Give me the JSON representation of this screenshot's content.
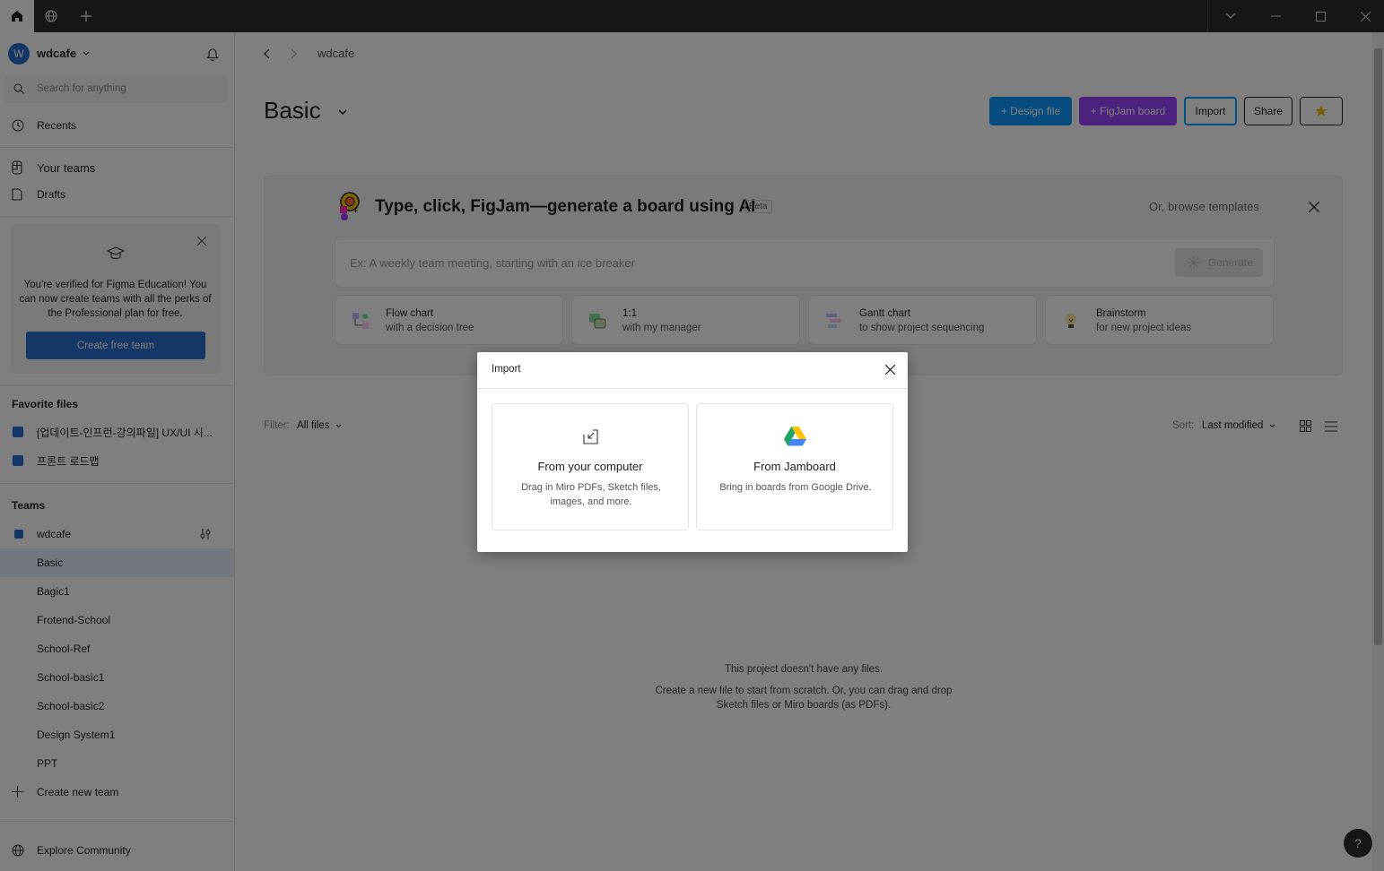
{
  "titlebar": {
    "tabs": [
      "home-tab",
      "community-tab",
      "new-tab"
    ]
  },
  "sidebar": {
    "account_initial": "W",
    "account_name": "wdcafe",
    "search_placeholder": "Search for anything",
    "recents": "Recents",
    "your_teams": "Your teams",
    "drafts": "Drafts",
    "edu_text": "You're verified for Figma Education! You can now create teams with all the perks of the Professional plan for free.",
    "edu_button": "Create free team",
    "favorite_files_heading": "Favorite files",
    "favorite_files": [
      "[업데이트-인프런-강의파일] UX/UI 시...",
      "프론트 로드맵"
    ],
    "teams_heading": "Teams",
    "team_name": "wdcafe",
    "projects": [
      "Basic",
      "Bagic1",
      "Frotend-School",
      "School-Ref",
      "School-basic1",
      "School-basic2",
      "Design System1",
      "PPT"
    ],
    "create_new_team": "Create new team",
    "explore_community": "Explore Community"
  },
  "main": {
    "breadcrumb": "wdcafe",
    "title": "Basic",
    "buttons": {
      "design_file": "+ Design file",
      "figjam_board": "+ FigJam board",
      "import": "Import",
      "share": "Share"
    },
    "ai_banner": {
      "title": "Type, click, FigJam—generate a board using AI",
      "badge": "Beta",
      "browse": "Or, browse templates",
      "placeholder": "Ex: A weekly team meeting, starting with an ice breaker",
      "generate": "Generate",
      "templates": [
        {
          "title": "Flow chart",
          "sub": "with a decision tree"
        },
        {
          "title": "1:1",
          "sub": "with my manager"
        },
        {
          "title": "Gantt chart",
          "sub": "to show project sequencing"
        },
        {
          "title": "Brainstorm",
          "sub": "for new project ideas"
        }
      ]
    },
    "filter_label": "Filter:",
    "filter_value": "All files",
    "sort_label": "Sort:",
    "sort_value": "Last modified",
    "empty_title": "This project doesn't have any files.",
    "empty_desc_1": "Create a new file to start from scratch. Or, you can drag and drop",
    "empty_desc_2": "Sketch files or Miro boards (as PDFs).",
    "help": "?"
  },
  "modal": {
    "title": "Import",
    "options": [
      {
        "title": "From your computer",
        "desc": "Drag in Miro PDFs, Sketch files, images, and more."
      },
      {
        "title": "From Jamboard",
        "desc": "Bring in boards from Google Drive."
      }
    ]
  },
  "colors": {
    "accent_blue": "#0d99ff",
    "figjam_purple": "#9747ff",
    "titlebar": "#2c2c2c"
  }
}
